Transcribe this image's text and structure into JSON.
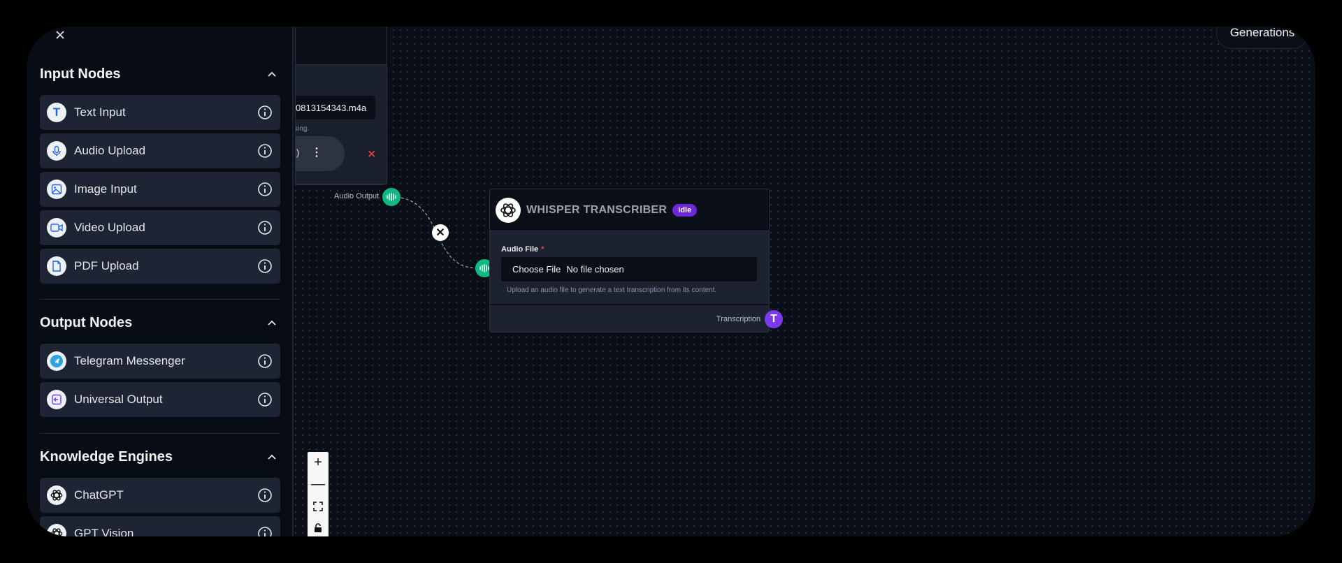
{
  "sidebar": {
    "sections": [
      {
        "title": "Input Nodes",
        "items": [
          {
            "label": "Text Input",
            "icon": "text-icon"
          },
          {
            "label": "Audio Upload",
            "icon": "microphone-icon"
          },
          {
            "label": "Image Input",
            "icon": "image-icon"
          },
          {
            "label": "Video Upload",
            "icon": "video-icon"
          },
          {
            "label": "PDF Upload",
            "icon": "file-icon"
          }
        ]
      },
      {
        "title": "Output Nodes",
        "items": [
          {
            "label": "Telegram Messenger",
            "icon": "telegram-icon"
          },
          {
            "label": "Universal Output",
            "icon": "output-icon"
          }
        ]
      },
      {
        "title": "Knowledge Engines",
        "items": [
          {
            "label": "ChatGPT",
            "icon": "openai-icon"
          },
          {
            "label": "GPT Vision",
            "icon": "openai-icon"
          }
        ]
      }
    ]
  },
  "header": {
    "generations_label": "Generations"
  },
  "source_node": {
    "file_name": "0813154343.m4a",
    "hint": "sing.",
    "output_label": "Audio Output"
  },
  "whisper_node": {
    "title": "WHISPER TRANSCRIBER",
    "status": "idle",
    "field_label": "Audio File",
    "required_mark": "*",
    "choose_file": "Choose File",
    "no_file": "No file chosen",
    "helper": "Upload an audio file to generate a text transcription from its content.",
    "output_label": "Transcription"
  },
  "colors": {
    "audio_handle": "#10b981",
    "text_handle": "#7c3aed",
    "status_badge": "#6d28d9"
  }
}
